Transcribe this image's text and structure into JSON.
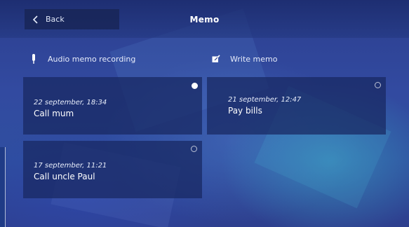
{
  "header": {
    "back_label": "Back",
    "title": "Memo"
  },
  "actions": {
    "audio_label": "Audio memo recording",
    "write_label": "Write memo"
  },
  "memos": [
    {
      "date": "22 september, 18:34",
      "text": "Call mum",
      "selected": true
    },
    {
      "date": "21 september, 12:47",
      "text": "Pay bills",
      "selected": false
    },
    {
      "date": "17 september, 11:21",
      "text": "Call uncle Paul",
      "selected": false
    }
  ],
  "icons": {
    "back": "chevron-left-icon",
    "audio": "microphone-icon",
    "write": "pen-checkbox-icon"
  },
  "colors": {
    "background": "#2c3f8f",
    "card": "#18285e",
    "text": "#ffffff"
  }
}
